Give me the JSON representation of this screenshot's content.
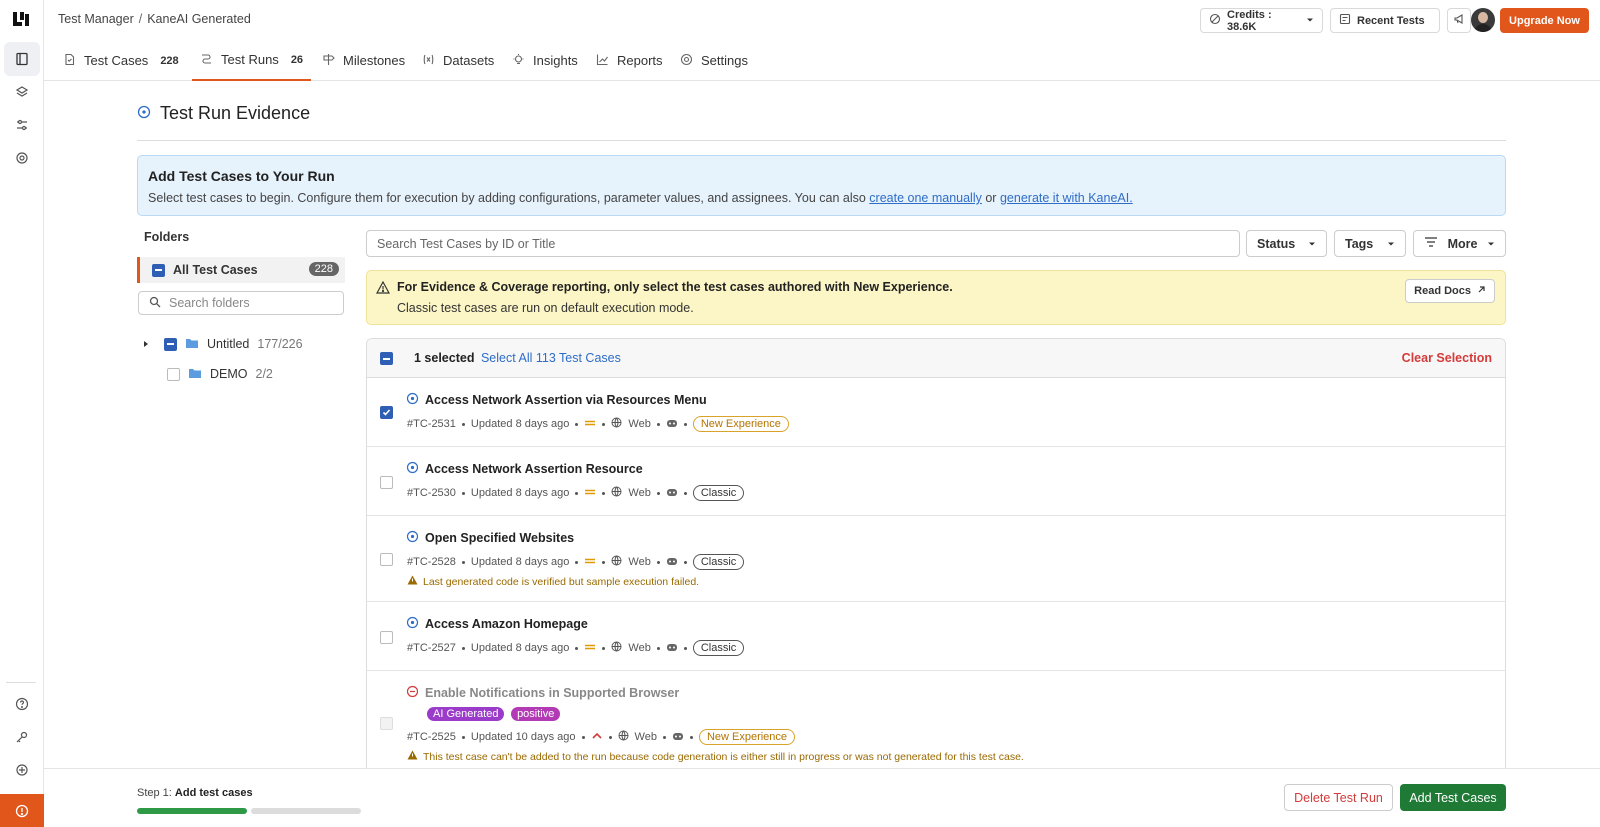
{
  "breadcrumb": {
    "root": "Test Manager",
    "sep": "/",
    "current": "KaneAI Generated"
  },
  "topbar": {
    "credits": "Credits : 38.6K",
    "recent_tests": "Recent Tests",
    "upgrade": "Upgrade Now",
    "accent": "#e0561b"
  },
  "tabs": [
    {
      "label": "Test Cases",
      "count": "228",
      "icon": "file-icon"
    },
    {
      "label": "Test Runs",
      "count": "26",
      "icon": "runs-icon"
    },
    {
      "label": "Milestones",
      "icon": "signpost-icon"
    },
    {
      "label": "Datasets",
      "icon": "variable-icon"
    },
    {
      "label": "Insights",
      "icon": "bulb-icon"
    },
    {
      "label": "Reports",
      "icon": "chart-icon"
    },
    {
      "label": "Settings",
      "icon": "gear-icon"
    }
  ],
  "page": {
    "title": "Test Run Evidence"
  },
  "info": {
    "heading": "Add Test Cases to Your Run",
    "text": "Select test cases to begin. Configure them for execution by adding configurations, parameter values, and assignees. You can also",
    "link1": "create one manually",
    "or": "or",
    "link2": "generate it with KaneAI."
  },
  "folders": {
    "heading": "Folders",
    "all_label": "All Test Cases",
    "all_count": "228",
    "search_placeholder": "Search folders",
    "items": [
      {
        "name": "Untitled",
        "count": "177/226"
      },
      {
        "name": "DEMO",
        "count": "2/2"
      }
    ]
  },
  "search": {
    "placeholder": "Search Test Cases by ID or Title"
  },
  "filters": {
    "status": "Status",
    "tags": "Tags",
    "more": "More"
  },
  "warning": {
    "line1": "For Evidence & Coverage reporting, only select the test cases authored with New Experience.",
    "line2": "Classic test cases are run on default execution mode.",
    "read_docs": "Read Docs"
  },
  "selection": {
    "count_text": "1 selected",
    "select_all": "Select All 113 Test Cases",
    "clear": "Clear Selection"
  },
  "rows": [
    {
      "title": "Access Network Assertion via Resources Menu",
      "id": "#TC-2531",
      "updated": "Updated 8 days ago",
      "platform": "Web",
      "badge": "New Experience"
    },
    {
      "title": "Access Network Assertion Resource",
      "id": "#TC-2530",
      "updated": "Updated 8 days ago",
      "platform": "Web",
      "badge": "Classic"
    },
    {
      "title": "Open Specified Websites",
      "id": "#TC-2528",
      "updated": "Updated 8 days ago",
      "platform": "Web",
      "badge": "Classic",
      "note": "Last generated code is verified but sample execution failed."
    },
    {
      "title": "Access Amazon Homepage",
      "id": "#TC-2527",
      "updated": "Updated 8 days ago",
      "platform": "Web",
      "badge": "Classic"
    },
    {
      "title": "Enable Notifications in Supported Browser",
      "id": "#TC-2525",
      "updated": "Updated 10 days ago",
      "platform": "Web",
      "badge": "New Experience",
      "tags": [
        "AI Generated",
        "positive"
      ],
      "note": "This test case can't be added to the run because code generation is either still in progress or was not generated for this test case."
    }
  ],
  "footer": {
    "step_prefix": "Step 1:",
    "step_label": "Add test cases",
    "progress": 0.5,
    "delete": "Delete Test Run",
    "add": "Add Test Cases"
  }
}
